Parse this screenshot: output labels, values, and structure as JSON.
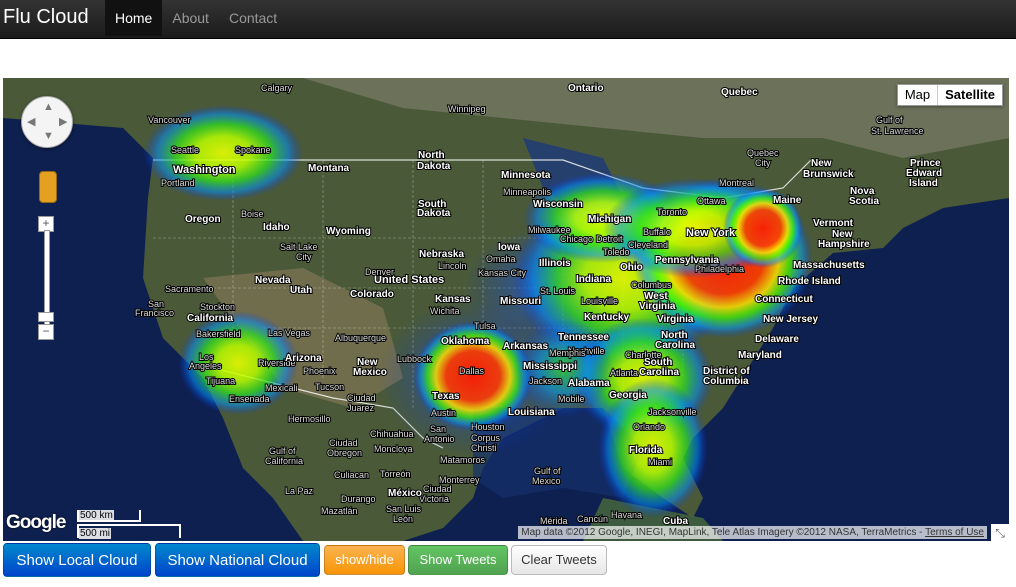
{
  "navbar": {
    "brand": "Flu Cloud",
    "items": [
      {
        "label": "Home",
        "active": true
      },
      {
        "label": "About",
        "active": false
      },
      {
        "label": "Contact",
        "active": false
      }
    ]
  },
  "map": {
    "type_control": {
      "map": "Map",
      "satellite": "Satellite",
      "selected": "Satellite"
    },
    "logo": "Google",
    "scale": {
      "km": "500 km",
      "mi": "500 mi"
    },
    "attribution": "Map data ©2012 Google, INEGI, MapLink, Tele Atlas Imagery ©2012 NASA, TerraMetrics - ",
    "terms": "Terms of Use",
    "labels": {
      "calgary": "Calgary",
      "winnipeg": "Winnipeg",
      "ontario": "Ontario",
      "quebec": "Quebec",
      "vancouver": "Vancouver",
      "seattle": "Seattle",
      "spokane": "Spokane",
      "washington": "Washington",
      "portland": "Portland",
      "montana": "Montana",
      "north_dakota_1": "North",
      "north_dakota_2": "Dakota",
      "minnesota": "Minnesota",
      "minneapolis": "Minneapolis",
      "oregon": "Oregon",
      "boise": "Boise",
      "idaho": "Idaho",
      "wyoming": "Wyoming",
      "south_dakota_1": "South",
      "south_dakota_2": "Dakota",
      "wisconsin": "Wisconsin",
      "milwaukee": "Milwaukee",
      "michigan": "Michigan",
      "chicago": "Chicago",
      "detroit": "Detroit",
      "toledo": "Toledo",
      "gulf_st_lawrence_1": "Gulf of",
      "gulf_st_lawrence_2": "St. Lawrence",
      "quebec_city_1": "Quebec",
      "quebec_city_2": "City",
      "montreal": "Montreal",
      "ottawa": "Ottawa",
      "toronto": "Toronto",
      "buffalo": "Buffalo",
      "maine": "Maine",
      "new_brunswick_1": "New",
      "new_brunswick_2": "Brunswick",
      "pei_1": "Prince",
      "pei_2": "Edward",
      "pei_3": "Island",
      "nova_scotia_1": "Nova",
      "nova_scotia_2": "Scotia",
      "vermont": "Vermont",
      "new_hampshire_1": "New",
      "new_hampshire_2": "Hampshire",
      "massachusetts": "Massachusetts",
      "rhode_island": "Rhode Island",
      "connecticut": "Connecticut",
      "new_jersey": "New Jersey",
      "delaware": "Delaware",
      "maryland": "Maryland",
      "dc_1": "District of",
      "dc_2": "Columbia",
      "new_york": "New York",
      "pennsylvania": "Pennsylvania",
      "philadelphia": "Philadelphia",
      "cleveland": "Cleveland",
      "ohio": "Ohio",
      "columbus": "Columbus",
      "west_virginia_1": "West",
      "west_virginia_2": "Virginia",
      "virginia": "Virginia",
      "indiana": "Indiana",
      "illinois": "Illinois",
      "iowa": "Iowa",
      "omaha": "Omaha",
      "nebraska": "Nebraska",
      "lincoln": "Lincoln",
      "united_states": "United States",
      "kansas_city": "Kansas City",
      "kansas": "Kansas",
      "wichita": "Wichita",
      "missouri": "Missouri",
      "st_louis": "St. Louis",
      "louisville": "Louisville",
      "kentucky": "Kentucky",
      "tennessee": "Tennessee",
      "nashville": "Nashville",
      "north_carolina_1": "North",
      "north_carolina_2": "Carolina",
      "charlotte": "Charlotte",
      "south_carolina_1": "South",
      "south_carolina_2": "Carolina",
      "georgia": "Georgia",
      "atlanta": "Atlanta",
      "alabama": "Alabama",
      "memphis": "Memphis",
      "mississippi": "Mississippi",
      "arkansas": "Arkansas",
      "jackson": "Jackson",
      "louisiana": "Louisiana",
      "mobile": "Mobile",
      "jacksonville": "Jacksonville",
      "orlando": "Orlando",
      "florida": "Florida",
      "miami": "Miami",
      "gulf_mexico_1": "Gulf of",
      "gulf_mexico_2": "Mexico",
      "nevada": "Nevada",
      "sacramento": "Sacramento",
      "san_francisco_1": "San",
      "san_francisco_2": "Francisco",
      "stockton": "Stockton",
      "california": "California",
      "salt_lake_1": "Salt Lake",
      "salt_lake_2": "City",
      "utah": "Utah",
      "denver": "Denver",
      "colorado": "Colorado",
      "las_vegas": "Las Vegas",
      "bakersfield": "Bakersfield",
      "los_angeles_1": "Los",
      "los_angeles_2": "Angeles",
      "riverside": "Riverside",
      "tijuana": "Tijuana",
      "mexicali": "Mexicali",
      "ensenada": "Ensenada",
      "arizona": "Arizona",
      "phoenix": "Phoenix",
      "tucson": "Tucson",
      "albuquerque": "Albuquerque",
      "new_mexico_1": "New",
      "new_mexico_2": "Mexico",
      "lubbock": "Lubbock",
      "oklahoma": "Oklahoma",
      "tulsa": "Tulsa",
      "dallas": "Dallas",
      "texas": "Texas",
      "austin": "Austin",
      "houston": "Houston",
      "san_antonio_1": "San",
      "san_antonio_2": "Antonio",
      "corpus_christi_1": "Corpus",
      "corpus_christi_2": "Christi",
      "ciudad_juarez_1": "Ciudad",
      "ciudad_juarez_2": "Juarez",
      "hermosillo": "Hermosillo",
      "chihuahua": "Chihuahua",
      "ciudad_obregon_1": "Ciudad",
      "ciudad_obregon_2": "Obregon",
      "gulf_california_1": "Gulf of",
      "gulf_california_2": "California",
      "monclova": "Monclova",
      "matamoros": "Matamoros",
      "culiacan": "Culiacan",
      "torreon": "Torreón",
      "monterrey": "Monterrey",
      "ciudad_victoria_1": "Ciudad",
      "ciudad_victoria_2": "Victoria",
      "la_paz": "La Paz",
      "durango": "Durango",
      "mexico": "México",
      "mazatlan": "Mazatlán",
      "san_luis": "San Luis",
      "leon": "León",
      "merida": "Mérida",
      "cancun": "Cancún",
      "cuba": "Cuba",
      "havana": "Havana"
    }
  },
  "buttons": {
    "local": "Show Local Cloud",
    "national": "Show National Cloud",
    "showhide": "show/hide",
    "tweets": "Show Tweets",
    "clear": "Clear Tweets"
  },
  "colors": {
    "primary": "#0055cc",
    "warning": "#f89406",
    "success": "#51a351",
    "heat_high": "#ff1a00",
    "heat_mid": "#ffff00",
    "heat_low": "#00ff00",
    "heat_edge": "#0050ff"
  }
}
